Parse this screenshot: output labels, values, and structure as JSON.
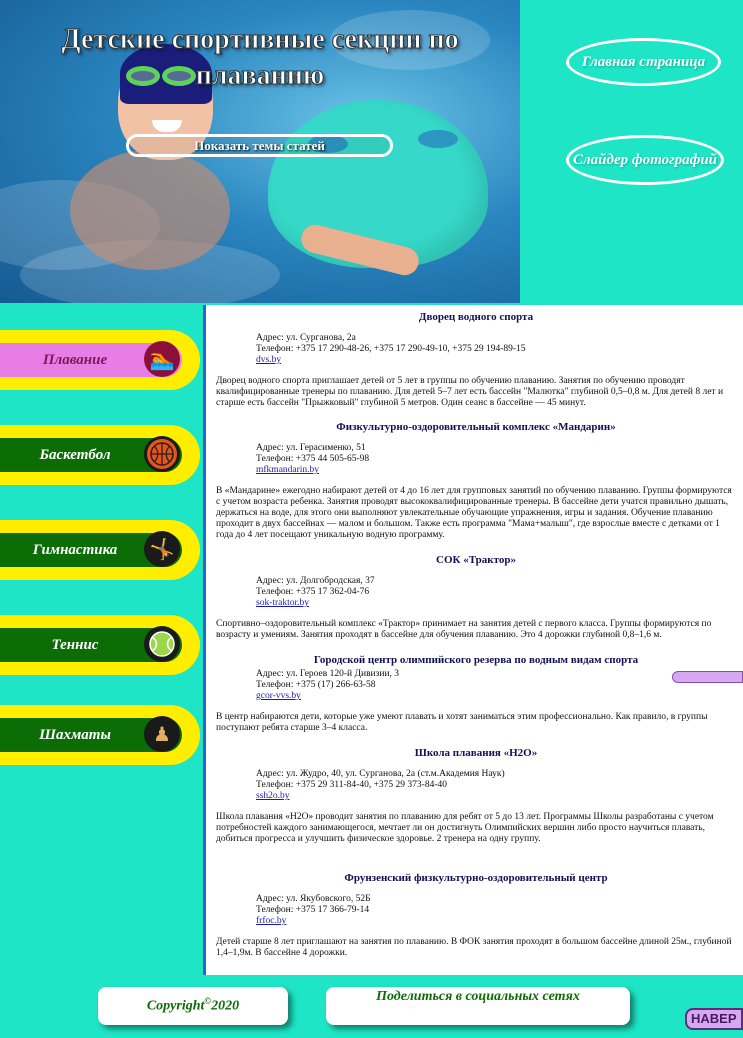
{
  "header": {
    "title": "Детские спортивные секции по плаванию",
    "topics_button": "Показать темы статей",
    "home_button": "Главная страница",
    "slider_button": "Слайдер фотографий"
  },
  "sidebar": {
    "items": [
      {
        "label": "Плавание",
        "icon": "swimming-icon",
        "active": true
      },
      {
        "label": "Баскетбол",
        "icon": "basketball-icon",
        "active": false
      },
      {
        "label": "Гимнастика",
        "icon": "gymnastics-icon",
        "active": false
      },
      {
        "label": "Теннис",
        "icon": "tennis-ball-icon",
        "active": false
      },
      {
        "label": "Шахматы",
        "icon": "chess-pawn-icon",
        "active": false
      }
    ]
  },
  "sections": [
    {
      "title": "Дворец водного спорта",
      "address": "Адрес: ул. Сурганова, 2а",
      "phone": "Телефон: +375 17 290-48-26, +375 17 290-49-10, +375 29 194-89-15",
      "link": "dvs.by",
      "text": "Дворец водного спорта приглашает детей от 5 лет в группы по обучению плаванию. Занятия по обучению проводят квалифицированные тренеры по плаванию. Для детей 5–7 лет есть бассейн \"Малютка\" глубиной 0,5–0,8 м. Для детей 8 лет и старше есть бассейн \"Прыжковый\" глубиной 5 метров. Один сеанс в бассейне — 45 минут."
    },
    {
      "title": "Физкультурно-оздоровительный комплекс «Мандарин»",
      "address": "Адрес: ул. Герасименко, 51",
      "phone": "Телефон: +375 44 505-65-98",
      "link": "mfkmandarin.by",
      "text": "В «Мандарине» ежегодно набирают детей от 4 до 16 лет для групповых занятий по обучению плаванию. Группы формируются с учетом возраста ребенка. Занятия проводят высококвалифицированные тренеры. В бассейне дети учатся правильно дышать, держаться на воде, для этого они выполняют увлекательные обучающие упражнения, игры и задания. Обучение плаванию проходит в двух бассейнах — малом и большом. Также есть программа \"Мама+малыш\", где взрослые вместе с детками от 1 года до 4 лет посещают уникальную водную программу."
    },
    {
      "title": "СОК «Трактор»",
      "address": "Адрес: ул. Долгобродская, 37",
      "phone": "Телефон: +375 17 362-04-76",
      "link": "sok-traktor.by",
      "text": "Спортивно–оздоровительный комплекс «Трактор» принимает на занятия детей с первого класса. Группы формируются по возрасту и умениям. Занятия проходят в бассейне для обучения плаванию. Это 4 дорожки глубиной 0,8–1,6 м."
    },
    {
      "title": "Городской центр олимпийского резерва по водным видам спорта",
      "address": "Адрес: ул. Героев 120-й Дивизии, 3",
      "phone": "Телефон: +375 (17) 266-63-58",
      "link": "gcor-vvs.by",
      "text": "В центр набираются дети, которые уже умеют плавать и хотят заниматься этим профессионально. Как правило, в группы поступают ребята старше 3–4 класса."
    },
    {
      "title": "Школа плавания «H2O»",
      "address": "Адрес: ул. Жудро, 40, ул. Сурганова, 2а (ст.м.Академия Наук)",
      "phone": "Телефон: +375 29 311-84-40, +375 29 373-84-40",
      "link": "ssh2o.by",
      "text": "Школа плавания «H2O» проводит занятия по плаванию для ребят от 5 до 13 лет. Программы Школы разработаны с учетом потребностей каждого занимающегося, мечтает ли он достигнуть Олимпийских вершин либо просто научиться плавать, добиться прогресса и улучшить физическое здоровье. 2 тренера на одну группу."
    },
    {
      "title": "Фрунзенский физкультурно-оздоровительный центр",
      "address": "Адрес: ул. Якубовского, 52Б",
      "phone": "Телефон: +375 17 366-79-14",
      "link": "frfoc.by",
      "text": "Детей старше 8 лет приглашают на занятия по плаванию. В ФОК занятия проходят в большом бассейне длиной 25м., глубиной 1,4–1,9м. В бассейне 4 дорожки."
    }
  ],
  "footer": {
    "copyright_text": "Copyright",
    "copyright_symbol": "©",
    "copyright_year": "2020",
    "share_label": "Поделиться в социальных сетях",
    "up_button": "НАВЕР"
  },
  "colors": {
    "background": "#1de5c6",
    "sidebar_outer": "#ffee00",
    "sidebar_inner": "#0c6c06",
    "sidebar_active": "#e87de6",
    "section_title": "#111055"
  }
}
